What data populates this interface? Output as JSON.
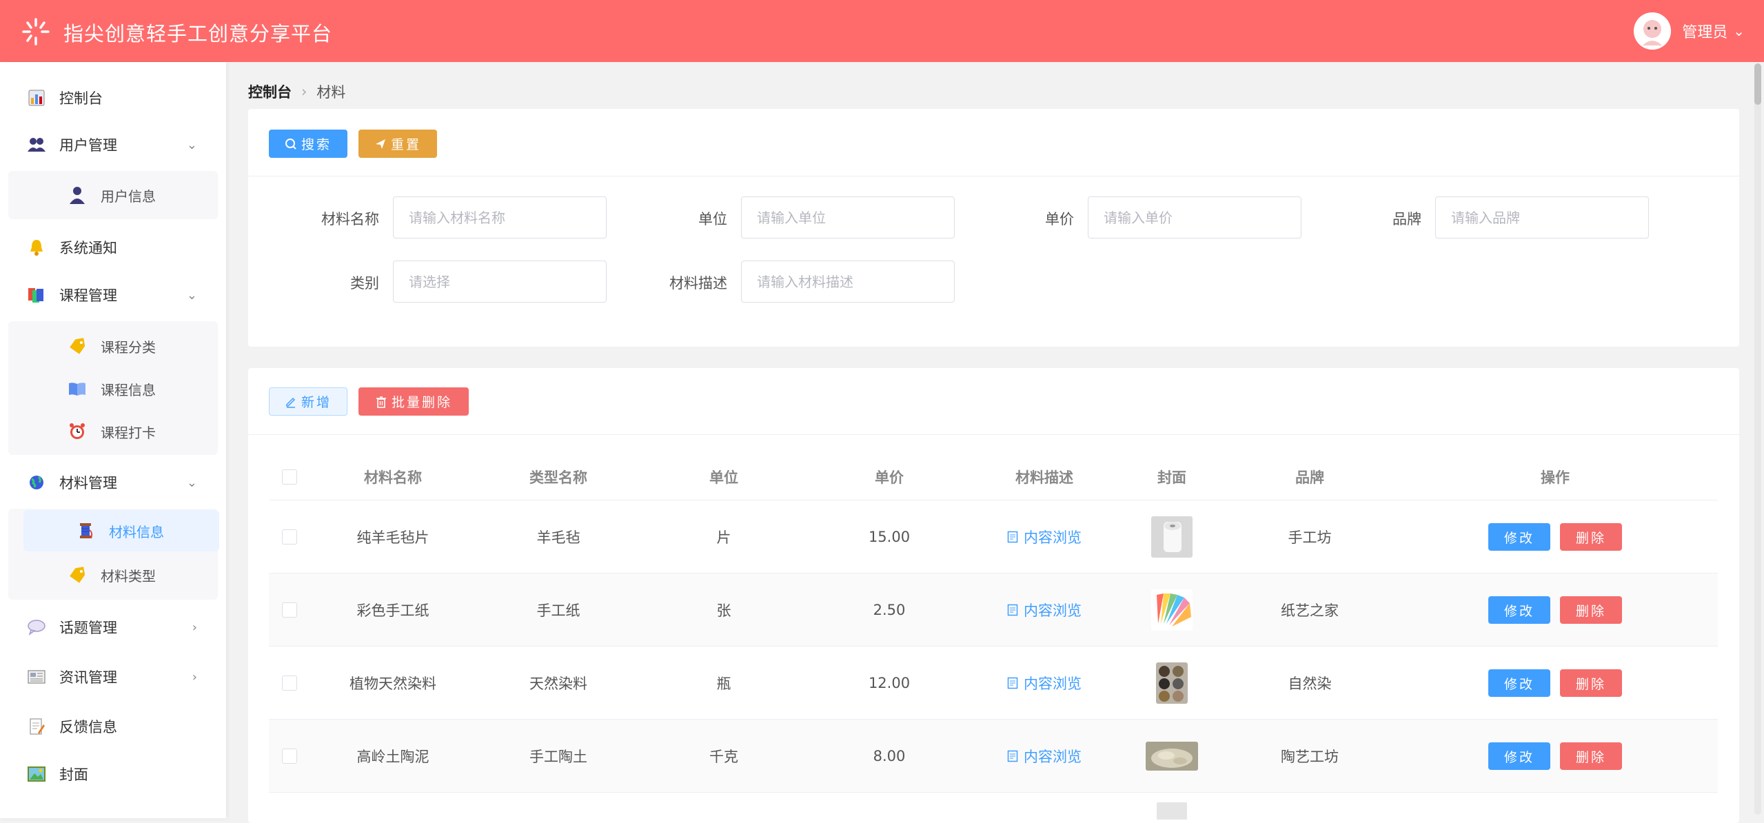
{
  "app": {
    "title": "指尖创意轻手工创意分享平台",
    "user": "管理员"
  },
  "sidebar": {
    "items": [
      {
        "label": "控制台",
        "icon": "chart-icon"
      },
      {
        "label": "用户管理",
        "icon": "users-icon"
      },
      {
        "label": "系统通知",
        "icon": "bell-icon"
      },
      {
        "label": "课程管理",
        "icon": "books-icon"
      },
      {
        "label": "材料管理",
        "icon": "globe-icon"
      },
      {
        "label": "话题管理",
        "icon": "speech-bubble-icon"
      },
      {
        "label": "资讯管理",
        "icon": "newspaper-icon"
      },
      {
        "label": "反馈信息",
        "icon": "memo-icon"
      },
      {
        "label": "封面",
        "icon": "picture-icon"
      }
    ],
    "sub_user": [
      {
        "label": "用户信息",
        "icon": "person-icon"
      }
    ],
    "sub_course": [
      {
        "label": "课程分类",
        "icon": "tag-icon"
      },
      {
        "label": "课程信息",
        "icon": "book-icon"
      },
      {
        "label": "课程打卡",
        "icon": "alarm-clock-icon"
      }
    ],
    "sub_material": [
      {
        "label": "材料信息",
        "icon": "thread-icon"
      },
      {
        "label": "材料类型",
        "icon": "tag-icon"
      }
    ]
  },
  "breadcrumb": {
    "home": "控制台",
    "current": "材料"
  },
  "toolbar": {
    "search": "搜索",
    "reset": "重置",
    "add": "新增",
    "batch_delete": "批量删除"
  },
  "form": {
    "name_label": "材料名称",
    "name_placeholder": "请输入材料名称",
    "unit_label": "单位",
    "unit_placeholder": "请输入单位",
    "price_label": "单价",
    "price_placeholder": "请输入单价",
    "brand_label": "品牌",
    "brand_placeholder": "请输入品牌",
    "category_label": "类别",
    "category_placeholder": "请选择",
    "desc_label": "材料描述",
    "desc_placeholder": "请输入材料描述"
  },
  "table": {
    "headers": [
      "材料名称",
      "类型名称",
      "单位",
      "单价",
      "材料描述",
      "封面",
      "品牌",
      "操作"
    ],
    "preview_label": "内容浏览",
    "edit_label": "修改",
    "delete_label": "删除",
    "rows": [
      {
        "name": "纯羊毛毡片",
        "type": "羊毛毡",
        "unit": "片",
        "price": "15.00",
        "brand": "手工坊",
        "cover": "white-roll"
      },
      {
        "name": "彩色手工纸",
        "type": "手工纸",
        "unit": "张",
        "price": "2.50",
        "brand": "纸艺之家",
        "cover": "color-fan"
      },
      {
        "name": "植物天然染料",
        "type": "天然染料",
        "unit": "瓶",
        "price": "12.00",
        "brand": "自然染",
        "cover": "dye-bowls"
      },
      {
        "name": "高岭土陶泥",
        "type": "手工陶土",
        "unit": "千克",
        "price": "8.00",
        "brand": "陶艺工坊",
        "cover": "clay-powder"
      }
    ]
  }
}
